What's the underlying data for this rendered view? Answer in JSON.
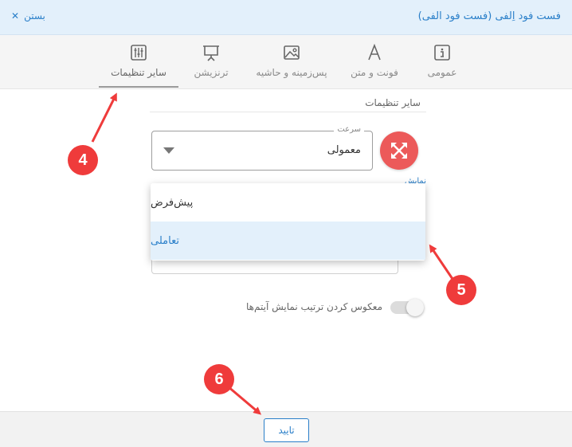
{
  "header": {
    "title": "فست فود اِلفی (فست فود الفی)",
    "close_label": "بستن"
  },
  "tabs": [
    {
      "label": "عمومی",
      "icon": "info-icon",
      "active": false
    },
    {
      "label": "فونت و متن",
      "icon": "font-icon",
      "active": false
    },
    {
      "label": "پس‌زمینه و حاشیه",
      "icon": "image-icon",
      "active": false
    },
    {
      "label": "ترنزیشن",
      "icon": "presentation-icon",
      "active": false
    },
    {
      "label": "سایر تنظیمات",
      "icon": "sliders-icon",
      "active": true
    }
  ],
  "section": {
    "title": "سایر تنظیمات"
  },
  "speed_select": {
    "label": "سرعت",
    "value": "معمولی"
  },
  "hint_link": "نمایش",
  "dropdown": {
    "options": [
      {
        "label": "پیش‌فرض",
        "selected": false
      },
      {
        "label": "تعاملی",
        "selected": true
      }
    ]
  },
  "reverse_toggle": {
    "label": "معکوس کردن ترتیب نمایش آیتم‌ها",
    "on": false
  },
  "footer": {
    "confirm_label": "تایید"
  },
  "annotations": [
    "4",
    "5",
    "6"
  ],
  "colors": {
    "accent": "#2a7fc9",
    "header_bg": "#e3f0fb",
    "fab": "#ec5a5a",
    "annotation": "#ef3b3b"
  }
}
